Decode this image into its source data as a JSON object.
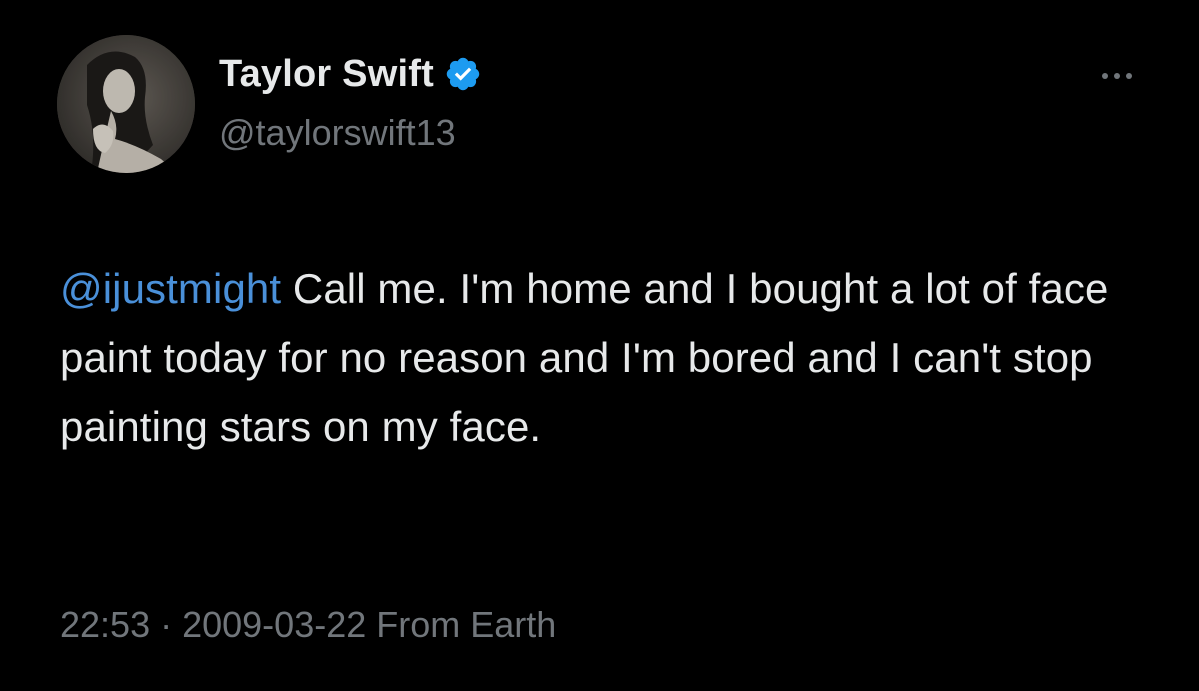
{
  "author": {
    "name": "Taylor Swift",
    "handle": "@taylorswift13",
    "verified": true,
    "verified_color": "#1d9bf0",
    "avatar_icon": "profile-photo"
  },
  "more_icon": "ellipsis-icon",
  "tweet": {
    "mention": "@ijustmight",
    "body": " Call me. I'm home and I bought a lot of face paint today for no reason and I'm bored and I can't stop painting stars on my face.",
    "mention_color": "#4a90d9"
  },
  "meta": {
    "time": "22:53",
    "separator": " · ",
    "date": "2009-03-22",
    "source": " From Earth"
  },
  "colors": {
    "background": "#000000",
    "text": "#e7e9ea",
    "secondary": "#71767b"
  }
}
